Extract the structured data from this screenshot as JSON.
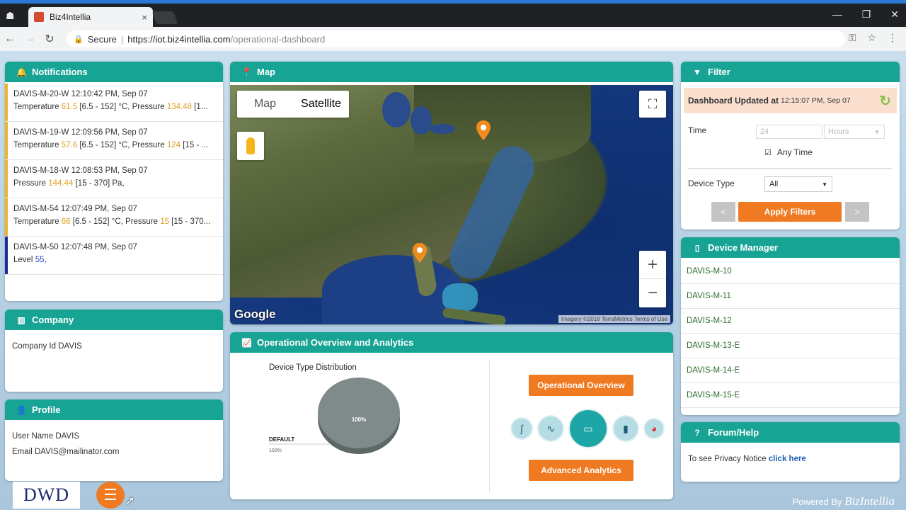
{
  "browser": {
    "tab_title": "Biz4Intellia",
    "tab_close": "×",
    "secure_label": "Secure",
    "url_host": "https://iot.biz4intellia.com",
    "url_path": "/operational-dashboard"
  },
  "notifications": {
    "title": "Notifications",
    "items": [
      {
        "head": "DAVIS-M-20-W 12:10:42 PM, Sep 07",
        "pre": "Temperature ",
        "v1": "61.5",
        "mid": " [6.5 - 152] °C, Pressure ",
        "v2": "134.48",
        "post": " [1..."
      },
      {
        "head": "DAVIS-M-19-W 12:09:56 PM, Sep 07",
        "pre": "Temperature ",
        "v1": "57.6",
        "mid": " [6.5 - 152] °C, Pressure ",
        "v2": "124",
        "post": " [15 - ..."
      },
      {
        "head": "DAVIS-M-18-W 12:08:53 PM, Sep 07",
        "pre": "Pressure ",
        "v1": "144.44",
        "mid": " [15 - 370] Pa,",
        "v2": "",
        "post": ""
      },
      {
        "head": "DAVIS-M-54 12:07:49 PM, Sep 07",
        "pre": "Temperature ",
        "v1": "66",
        "mid": " [6.5 - 152] °C, Pressure ",
        "v2": "15",
        "post": " [15 - 370..."
      },
      {
        "head": "DAVIS-M-50 12:07:48 PM, Sep 07",
        "pre": "Level ",
        "v1": "55,",
        "mid": "",
        "v2": "",
        "post": ""
      }
    ]
  },
  "company": {
    "title": "Company",
    "line": "Company Id DAVIS"
  },
  "profile": {
    "title": "Profile",
    "user": "User Name DAVIS",
    "email": "Email DAVIS@mailinator.com"
  },
  "map": {
    "title": "Map",
    "type_map": "Map",
    "type_satellite": "Satellite",
    "zoom_in": "+",
    "zoom_out": "−",
    "google": "Google",
    "attribution": "Imagery ©2018 TerraMetrics  Terms of Use"
  },
  "analytics": {
    "title": "Operational Overview and Analytics",
    "chart_title": "Device Type Distribution",
    "legend_label": "DEFAULT",
    "legend_value": "100%",
    "slice_label": "100%",
    "btn_overview": "Operational Overview",
    "btn_advanced": "Advanced Analytics"
  },
  "chart_data": {
    "type": "pie",
    "title": "Device Type Distribution",
    "categories": [
      "DEFAULT"
    ],
    "values": [
      100
    ],
    "colors": [
      "#7e8b8a"
    ]
  },
  "filter": {
    "title": "Filter",
    "updated_label": "Dashboard Updated at",
    "updated_time": "12:15:07 PM, Sep 07",
    "time_label": "Time",
    "time_placeholder": "24",
    "unit_placeholder": "Hours",
    "any_time": "Any Time",
    "device_type_label": "Device Type",
    "device_type_value": "All",
    "apply": "Apply Filters",
    "prev": "<",
    "next": ">"
  },
  "device_manager": {
    "title": "Device Manager",
    "items": [
      "DAVIS-M-10",
      "DAVIS-M-11",
      "DAVIS-M-12",
      "DAVIS-M-13-E",
      "DAVIS-M-14-E",
      "DAVIS-M-15-E"
    ]
  },
  "forum": {
    "title": "Forum/Help",
    "text": "To see Privacy Notice ",
    "link": "click here"
  },
  "footer": {
    "logo_text": "DWD",
    "powered_by": "Powered By ",
    "brand": "BizIntellia"
  },
  "colors": {
    "teal_header": "#17a495",
    "orange_button": "#f07a22",
    "warning_bar": "#f0b429",
    "info_bar": "#1f2a9a"
  }
}
